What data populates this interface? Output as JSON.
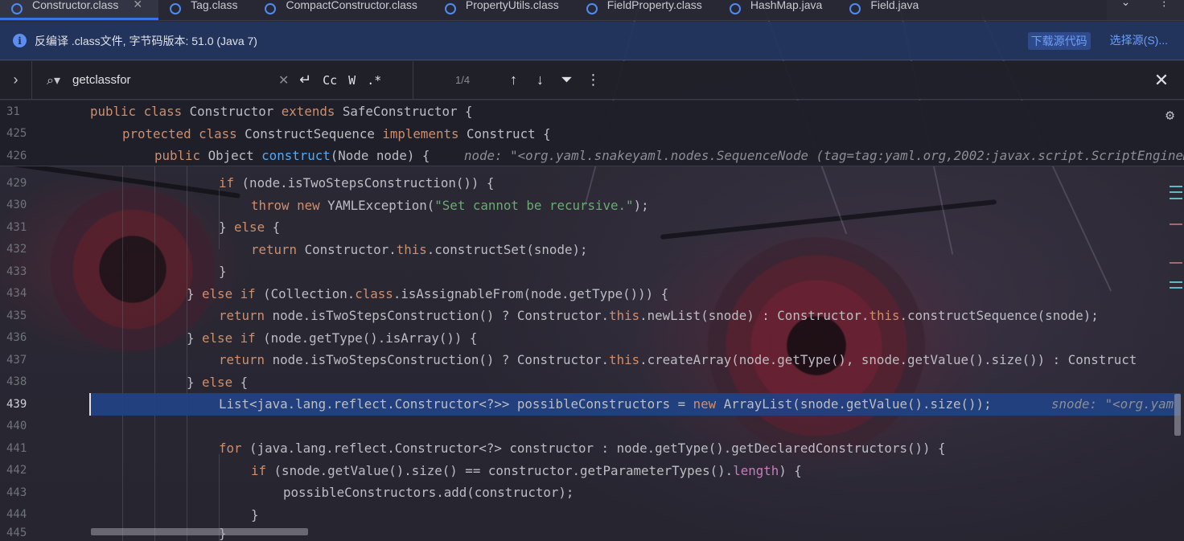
{
  "tabs": [
    {
      "label": "Constructor.class",
      "active": true,
      "closable": true
    },
    {
      "label": "Tag.class"
    },
    {
      "label": "CompactConstructor.class"
    },
    {
      "label": "PropertyUtils.class"
    },
    {
      "label": "FieldProperty.class"
    },
    {
      "label": "HashMap.java"
    },
    {
      "label": "Field.java"
    }
  ],
  "banner": {
    "message": "反编译 .class文件, 字节码版本: 51.0 (Java 7)",
    "download_label": "下载源代码",
    "choose_label": "选择源(S)..."
  },
  "search": {
    "query": "getclassfor",
    "match_case_label": "Cc",
    "words_label": "W",
    "regex_label": ".*",
    "match_count": "1/4"
  },
  "editor": {
    "current_line": "439",
    "sticky_lines": [
      {
        "num": "31"
      },
      {
        "num": "425"
      },
      {
        "num": "426",
        "hint": "node: \"<org.yaml.snakeyaml.nodes.SequenceNode (tag=tag:yaml.org,2002:javax.script.ScriptEngineManager"
      }
    ],
    "line_numbers": [
      "429",
      "430",
      "431",
      "432",
      "433",
      "434",
      "435",
      "436",
      "437",
      "438",
      "439",
      "440",
      "441",
      "442",
      "443",
      "444",
      "445"
    ],
    "hint_439": "snode: \"<org.yam"
  },
  "colors": {
    "keyword": "#cf8e6d",
    "string": "#6aab73",
    "function": "#56a8f5",
    "field": "#c77dbb",
    "selection": "#214283",
    "banner_bg": "#233560",
    "link": "#6e9ef6"
  },
  "icons": [
    "class-file-icon",
    "info-icon",
    "search-icon",
    "newline-icon",
    "prev-match-icon",
    "next-match-icon",
    "filter-icon",
    "more-icon",
    "close-icon",
    "gear-icon",
    "expand-icon",
    "tab-overflow-chevron-icon"
  ]
}
